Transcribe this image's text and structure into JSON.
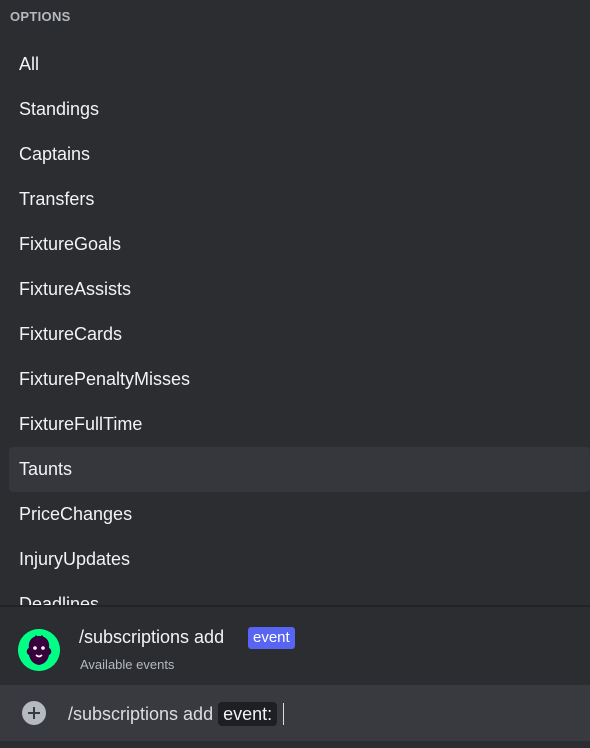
{
  "options": {
    "header": "OPTIONS",
    "items": [
      {
        "label": "All"
      },
      {
        "label": "Standings"
      },
      {
        "label": "Captains"
      },
      {
        "label": "Transfers"
      },
      {
        "label": "FixtureGoals"
      },
      {
        "label": "FixtureAssists"
      },
      {
        "label": "FixtureCards"
      },
      {
        "label": "FixturePenaltyMisses"
      },
      {
        "label": "FixtureFullTime"
      },
      {
        "label": "Taunts",
        "selected": true
      },
      {
        "label": "PriceChanges"
      },
      {
        "label": "InjuryUpdates"
      },
      {
        "label": "Deadlines"
      }
    ]
  },
  "command": {
    "name": "/subscriptions add",
    "tag": "event",
    "description": "Available events",
    "avatar_icon": "premier-league-lion-icon"
  },
  "input": {
    "command_text": "/subscriptions add",
    "param_label": "event:",
    "add_icon": "plus-circle-icon"
  },
  "colors": {
    "background": "#2b2d31",
    "selected_row": "#35373c",
    "tag_blue": "#5865f2",
    "avatar_green": "#00ff85",
    "input_bar": "#383a40"
  }
}
